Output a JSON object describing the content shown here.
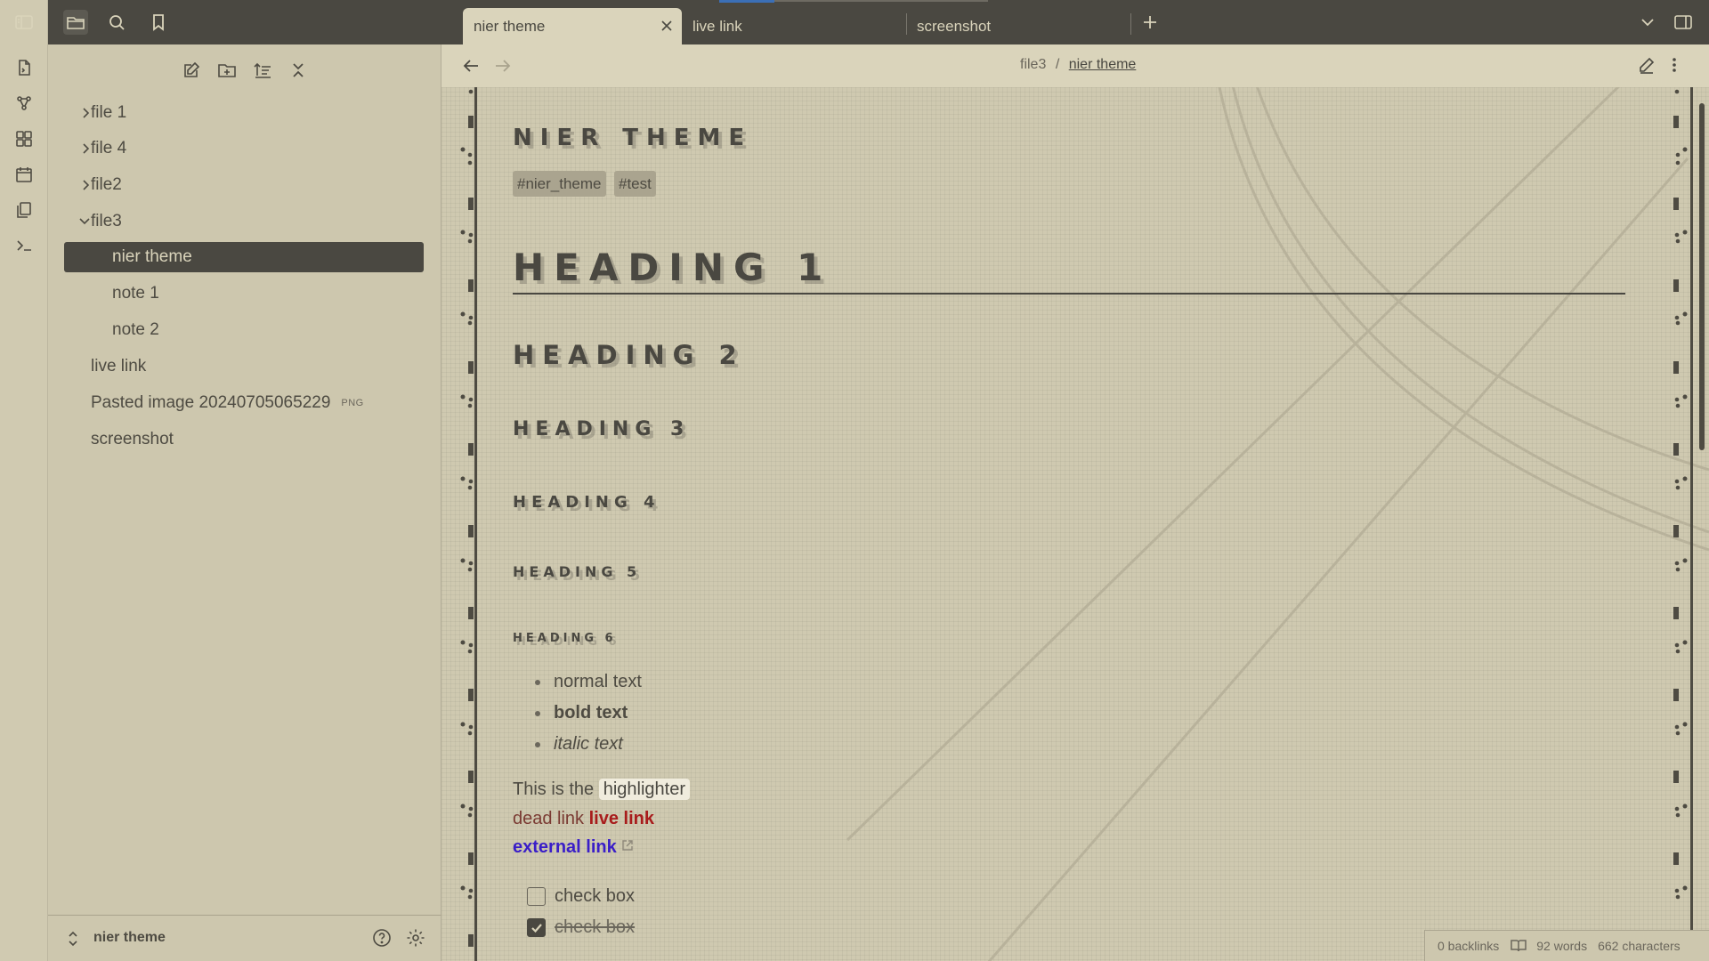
{
  "colors": {
    "accent_dark": "#4a4841",
    "paper": "#dad4bb",
    "sidebar": "#cdc7ae",
    "live_link": "#a81c1c",
    "external_link": "#3a1ec8",
    "dead_link": "#7a3a32"
  },
  "ribbon": {
    "icons": [
      "switcher-icon",
      "graph-icon",
      "canvas-icon",
      "calendar-icon",
      "templates-icon",
      "terminal-icon"
    ]
  },
  "sidebar_top": {
    "icons": [
      "toggle-sidebar-icon",
      "folder-icon",
      "search-icon",
      "bookmark-icon"
    ]
  },
  "nav_actions": {
    "icons": [
      "new-note-icon",
      "new-folder-icon",
      "sort-icon",
      "collapse-all-icon"
    ]
  },
  "tree": {
    "items": [
      {
        "label": "file 1",
        "type": "folder",
        "expanded": false
      },
      {
        "label": "file 4",
        "type": "folder",
        "expanded": false
      },
      {
        "label": "file2",
        "type": "folder",
        "expanded": false
      },
      {
        "label": "file3",
        "type": "folder",
        "expanded": true
      },
      {
        "label": "nier theme",
        "type": "file",
        "selected": true
      },
      {
        "label": "note 1",
        "type": "file"
      },
      {
        "label": "note 2",
        "type": "file"
      },
      {
        "label": "live link",
        "type": "file"
      },
      {
        "label": "Pasted image 20240705065229",
        "type": "file",
        "ext": "PNG"
      },
      {
        "label": "screenshot",
        "type": "file"
      }
    ]
  },
  "sidebar_footer": {
    "vault_name": "nier theme",
    "icons": [
      "help-icon",
      "settings-icon"
    ]
  },
  "tabs": [
    {
      "label": "nier theme",
      "active": true
    },
    {
      "label": "live link",
      "active": false
    },
    {
      "label": "screenshot",
      "active": false
    }
  ],
  "breadcrumb": {
    "parent": "file3",
    "separator": "/",
    "current": "nier theme"
  },
  "document": {
    "title": "NIER THEME",
    "tags": [
      "#nier_theme",
      "#test"
    ],
    "headings": {
      "h1": "HEADING 1",
      "h2": "HEADING 2",
      "h3": "HEADING 3",
      "h4": "HEADING 4",
      "h5": "HEADING 5",
      "h6": "HEADING 6"
    },
    "bullets": {
      "normal": "normal text",
      "bold": "bold text",
      "italic": "italic text"
    },
    "highlight_line": {
      "prefix": "This is the",
      "highlight": "highlighter"
    },
    "links": {
      "dead": "dead link",
      "live": "live link",
      "external": "external link"
    },
    "checkboxes": [
      {
        "label": "check box",
        "checked": false
      },
      {
        "label": "check box",
        "checked": true
      }
    ]
  },
  "status": {
    "backlinks": "0 backlinks",
    "words": "92 words",
    "characters": "662 characters"
  }
}
